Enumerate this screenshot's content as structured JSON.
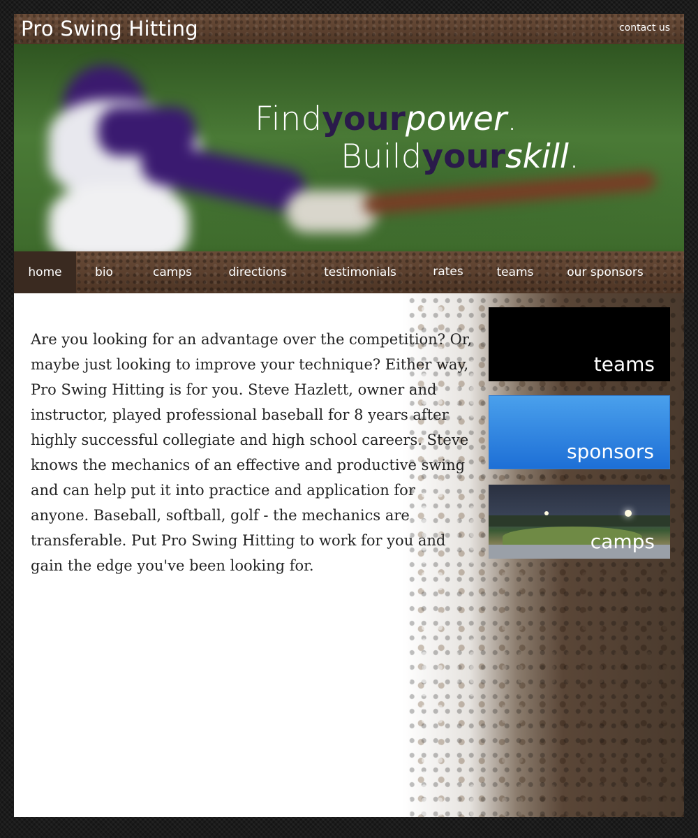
{
  "header": {
    "site_title": "Pro Swing Hitting",
    "contact_label": "contact us"
  },
  "hero": {
    "line1": {
      "a": "Find",
      "b": "your",
      "c": "power",
      "d": "."
    },
    "line2": {
      "a": "Build",
      "b": "your",
      "c": "skill",
      "d": "."
    }
  },
  "nav": {
    "items": [
      {
        "label": "home",
        "active": true
      },
      {
        "label": "bio"
      },
      {
        "label": "camps"
      },
      {
        "label": "directions"
      },
      {
        "label": "testimonials"
      },
      {
        "label": "rates"
      },
      {
        "label": "teams"
      },
      {
        "label": "our sponsors"
      }
    ]
  },
  "main": {
    "intro": "Are you looking for an advantage over the competition? Or, maybe just looking to improve your technique? Either way, Pro Swing Hitting is for you. Steve Hazlett, owner and instructor, played professional baseball for 8 years after highly successful collegiate and high school careers. Steve knows the mechanics of an effective and productive swing and can help put it into practice and application for anyone. Baseball, softball, golf - the mechanics are transferable. Put Pro Swing Hitting to work for you and gain the edge you've been looking for."
  },
  "sidebar": {
    "teams": "teams",
    "sponsors": "sponsors",
    "camps": "camps"
  }
}
